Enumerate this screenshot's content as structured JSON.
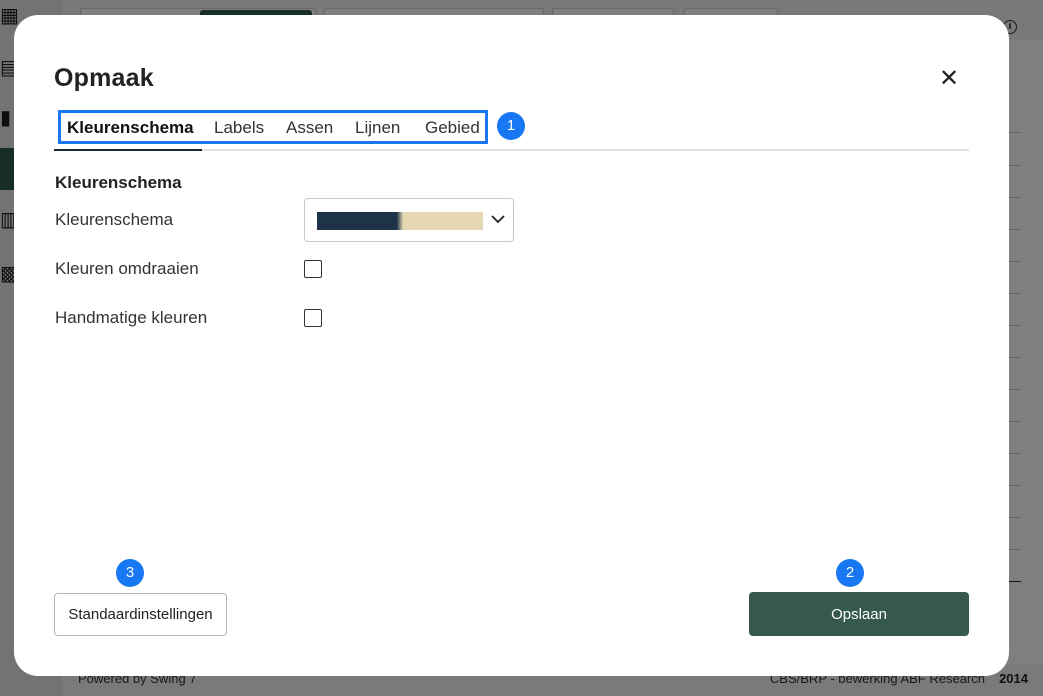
{
  "modal": {
    "title": "Opmaak",
    "close_icon": "close-icon"
  },
  "tabs": [
    {
      "label": "Kleurenschema",
      "active": true
    },
    {
      "label": "Labels",
      "active": false
    },
    {
      "label": "Assen",
      "active": false
    },
    {
      "label": "Lijnen",
      "active": false
    },
    {
      "label": "Gebied",
      "active": false
    }
  ],
  "section": {
    "title": "Kleurenschema"
  },
  "fields": {
    "color_scheme": {
      "label": "Kleurenschema",
      "colors": [
        "#1e3248",
        "#e6d8b3"
      ]
    },
    "reverse_colors": {
      "label": "Kleuren omdraaien",
      "checked": false
    },
    "manual_colors": {
      "label": "Handmatige kleuren",
      "checked": false
    }
  },
  "buttons": {
    "defaults_label": "Standaardinstellingen",
    "save_label": "Opslaan"
  },
  "badges": {
    "one": "1",
    "two": "2",
    "three": "3"
  },
  "background": {
    "footer_left": "Powered by Swing 7",
    "footer_right": "CBS/BRP - bewerking ABF Research",
    "footer_year": "2014"
  },
  "colors": {
    "accent": "#1877f2",
    "primary_button": "#36594d"
  }
}
